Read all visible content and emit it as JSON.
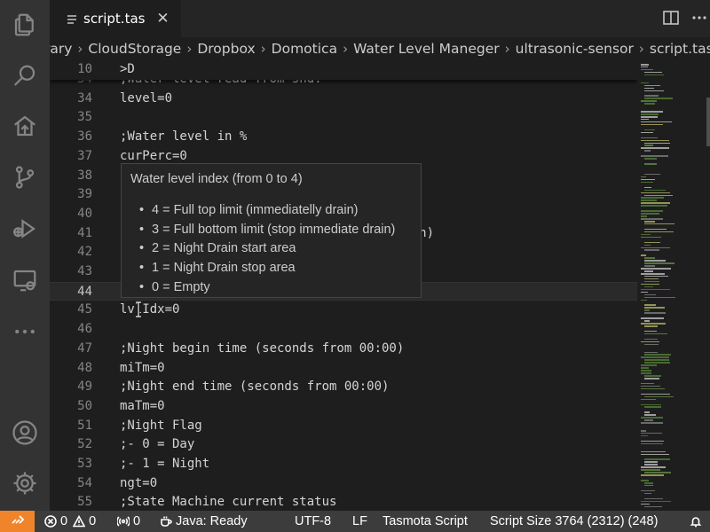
{
  "tab": {
    "label": "script.tas"
  },
  "breadcrumb": [
    "rary",
    "CloudStorage",
    "Dropbox",
    "Domotica",
    "Water Level Maneger",
    "ultrasonic-sensor",
    "script.tas"
  ],
  "sticky_line": {
    "number": "10",
    "code": ">D"
  },
  "lines": [
    {
      "n": "34",
      "code": ";Water level read from snd.",
      "type": "comment"
    },
    {
      "n": "34",
      "code": "level=0",
      "type": "code"
    },
    {
      "n": "35",
      "code": "",
      "type": "code"
    },
    {
      "n": "36",
      "code": ";Water level in %",
      "type": "comment"
    },
    {
      "n": "37",
      "code": "curPerc=0",
      "type": "code"
    },
    {
      "n": "38",
      "code": "",
      "type": "code"
    },
    {
      "n": "39",
      "code": "",
      "type": "code"
    },
    {
      "n": "40",
      "code": "                                  in)",
      "type": "comment"
    },
    {
      "n": "41",
      "code": "                                  e drain)",
      "type": "comment"
    },
    {
      "n": "42",
      "code": "",
      "type": "code"
    },
    {
      "n": "43",
      "code": "",
      "type": "code"
    },
    {
      "n": "44",
      "code": "",
      "type": "current"
    },
    {
      "n": "45",
      "code": "lvlIdx=0",
      "type": "code"
    },
    {
      "n": "46",
      "code": "",
      "type": "code"
    },
    {
      "n": "47",
      "code": ";Night begin time (seconds from 00:00)",
      "type": "comment"
    },
    {
      "n": "48",
      "code": "miTm=0",
      "type": "code"
    },
    {
      "n": "49",
      "code": ";Night end time (seconds from 00:00)",
      "type": "comment"
    },
    {
      "n": "50",
      "code": "maTm=0",
      "type": "code"
    },
    {
      "n": "51",
      "code": ";Night Flag",
      "type": "comment"
    },
    {
      "n": "52",
      "code": ";- 0 = Day",
      "type": "comment"
    },
    {
      "n": "53",
      "code": ";- 1 = Night",
      "type": "comment"
    },
    {
      "n": "54",
      "code": "ngt=0",
      "type": "code"
    },
    {
      "n": "55",
      "code": ";State Machine current status",
      "type": "comment"
    }
  ],
  "hover": {
    "title": "Water level index (from 0 to 4)",
    "items": [
      "4 = Full top limit (immediatelly drain)",
      "3 = Full bottom limit (stop immediate drain)",
      "2 = Night Drain start area",
      "1 = Night Drain stop area",
      "0 = Empty"
    ]
  },
  "status_bar": {
    "errors": "0",
    "warnings": "0",
    "ports": "0",
    "java": "Java: Ready",
    "encoding": "UTF-8",
    "eol": "LF",
    "language": "Tasmota Script",
    "script_size": "Script Size 3764 (2312) (248)"
  },
  "activity_icons": [
    "files-icon",
    "search-icon",
    "tasmota-icon",
    "source-control-icon",
    "run-debug-icon",
    "remote-explorer-icon",
    "more-icon",
    "account-icon",
    "settings-gear-icon"
  ],
  "colors": {
    "status_remote": "#f0842b",
    "section_marker": "#f14c7a"
  }
}
